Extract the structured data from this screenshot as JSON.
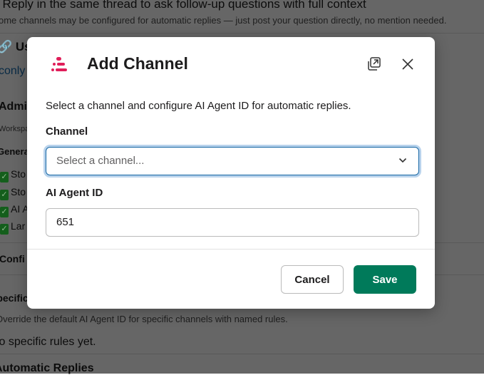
{
  "background": {
    "line1": ": Reply in the same thread to ask follow-up questions with full context",
    "line2": "ome channels may be configured for automatic replies — just post your question directly, no mention needed.",
    "usage_heading": "Us",
    "link": "conly",
    "admin_heading": "Admi",
    "workspace_text": "Workspa",
    "general_heading": "Genera",
    "checks": [
      "Sto",
      "Sto",
      "AI A",
      "Lar"
    ],
    "config_heading": "Confi",
    "specific_heading": "Specific",
    "specific_desc": "Override the default AI Agent ID for specific channels with named rules.",
    "no_rules": "No specific rules yet.",
    "auto_heading": "Automatic Replies"
  },
  "modal": {
    "title": "Add Channel",
    "description": "Select a channel and configure AI Agent ID for automatic replies.",
    "channel_label": "Channel",
    "channel_placeholder": "Select a channel...",
    "agent_label": "AI Agent ID",
    "agent_value": "651",
    "cancel_label": "Cancel",
    "save_label": "Save",
    "brand_color": "#e01e5a",
    "save_color": "#007a5a"
  }
}
